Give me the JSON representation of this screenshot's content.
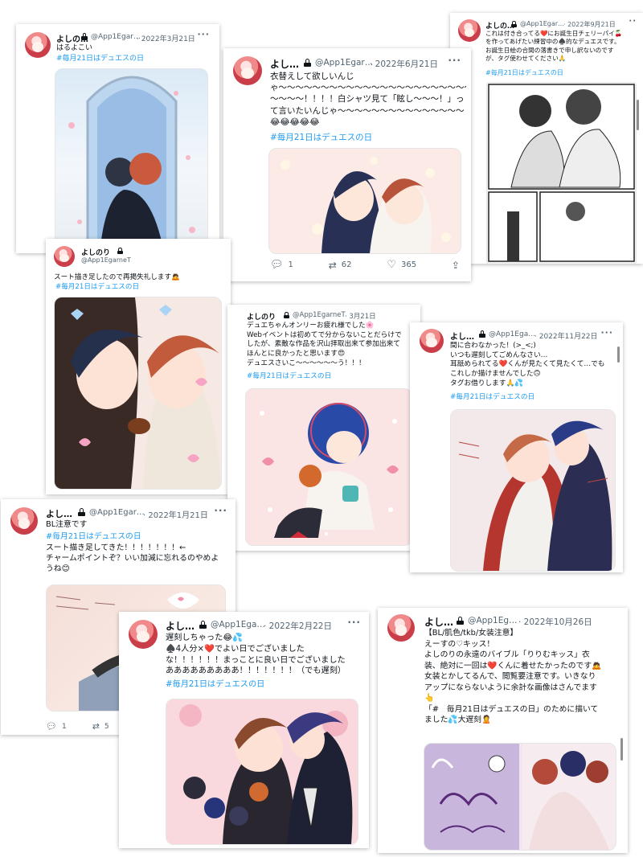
{
  "tweets": {
    "t1": {
      "name": "よしの…",
      "handle": "@App1Egar…",
      "date": "· 2022年3月21日",
      "text": "はるよこい",
      "tag": "#毎月21日はデュエスの日"
    },
    "t2": {
      "name": "よし…",
      "handle": "@App1Egar…",
      "date": "· 2022年6月21日",
      "text": "衣替えして欲しいんじ\nゃ〜〜〜〜〜〜〜〜〜〜〜〜〜〜〜〜〜〜〜〜〜〜〜〜〜〜〜〜〜〜〜\n〜〜〜〜！！！！白シャツ見て「眩し〜〜〜！」っ\nて言いたいんじゃ〜〜〜〜〜〜〜〜〜〜〜〜〜〜〜\n😂😂😂😂😂",
      "tag": "#毎月21日はデュエスの日",
      "reply": "1",
      "retweet": "62",
      "like": "365"
    },
    "t3": {
      "name": "よしの…",
      "handle": "@App1Egar…",
      "date": "· 2022年9月21日",
      "text": "これは付き合ってる❤️にお誕生日チェリーパイ🍒\nを作ってあげたい練習中の♠️的なデュエスです。\nお誕生日絵の合間の落書きで申し訳ないのです\nが、タグ使わせてください🙏",
      "tag": "#毎月21日はデュエスの日"
    },
    "t4": {
      "name": "よしのり",
      "handle": "@App1EgarneT",
      "text": "スート描き足したので再掲失礼します🙇",
      "tag": "#毎月21日はデュエスの日"
    },
    "t5": {
      "name": "よしのり",
      "handle": "@App1EgarneT",
      "date": "· 3月21日",
      "text": "デュエちゃんオンリーお疲れ様でした🌸\nWebイベントは初めてで分からないことだらけで\nしたが、素敵な作品を沢山拝取出来て参加出来て\nほんとに良かったと思います😍\nデュエスさいこ〜〜〜〜〜〜う！！！",
      "tag": "#毎月21日はデュエスの日"
    },
    "t6": {
      "name": "よし…",
      "handle": "@App1Ega…",
      "date": "· 2022年11月22日",
      "text": "間に合わなかった！(>_<;)\nいつも遅刻してごめんなさい…\n耳舐められてる❤️くんが見たくて見たくて…でも\nこれしか描けませんでした🙃\nタグお借りします🙏💦",
      "tag": "#毎月21日はデュエスの日"
    },
    "t7": {
      "name": "よし…",
      "handle": "@App1Egar…",
      "date": "· 2022年1月21日",
      "text": "BL注意です",
      "tag": "#毎月21日はデュエスの日",
      "text2": "スート描き足してきた！！！！！！！←\nチャームポイントぞ？いい加減に忘れるのやめよ\nうね😊",
      "reply": "1",
      "retweet": "5"
    },
    "t8": {
      "name": "よし…",
      "handle": "@App1Ega…",
      "date": "· 2022年2月22日",
      "text": "遅刻しちゃった😂💦\n♠️4人分×❤️でよい日でございました\nな！！！！！！まっことに良い日でございました\nあああああああああ！！！！！！！（でも遅刻）",
      "tag": "#毎月21日はデュエスの日"
    },
    "t9": {
      "name": "よし…",
      "handle": "@App1Eg…",
      "date": "· 2022年10月26日",
      "text": "【BL/肌色/tkb/女装注意】\nえーすの♡キッス！\nよしのりの永遠のバイブル「りりむキッス」衣\n装、絶対に一回は❤️くんに着せたかったのです🙇\n女装とかしてるんで、閲覧要注意です。いきなり\nアップにならないように余計な画像はさんでます\n👆\n「#　毎月21日はデュエスの日」のために描いて\nました💦大遅刻🙎"
    }
  },
  "colors": {
    "accent": "#1d9bf0",
    "muted": "#536471",
    "text": "#0f1419"
  }
}
